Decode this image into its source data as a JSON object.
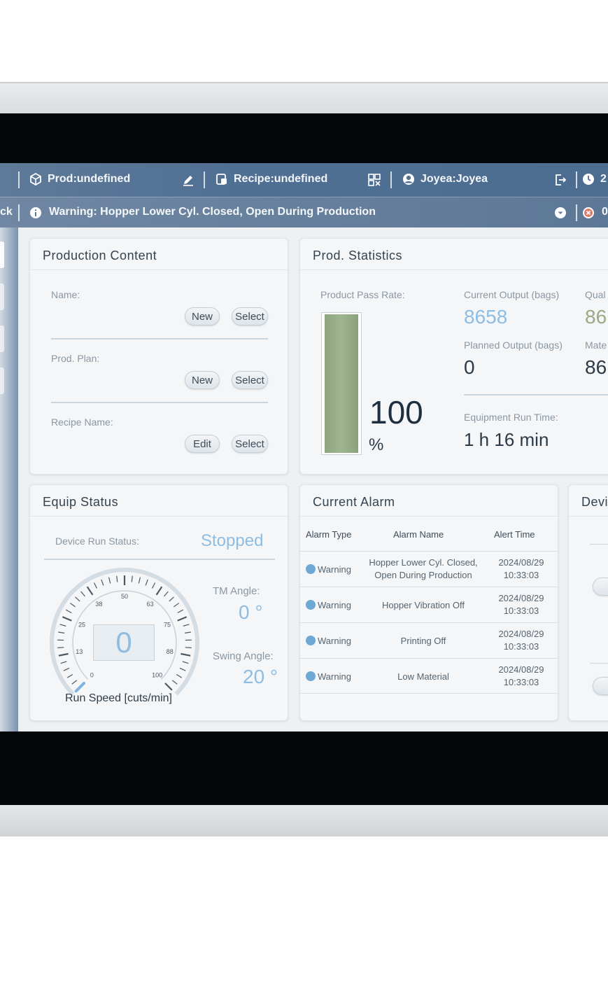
{
  "topbar": {
    "prod_label": "Prod:undefined",
    "recipe_label": "Recipe:undefined",
    "user_label": "Joyea:Joyea",
    "clock_partial": "2"
  },
  "warnbar": {
    "left_fragment": "ck",
    "warning_text": "Warning:  Hopper Lower Cyl. Closed, Open During Production",
    "right_fragment": "0"
  },
  "production_content": {
    "title": "Production Content",
    "name_label": "Name:",
    "plan_label": "Prod. Plan:",
    "recipe_label": "Recipe Name:",
    "new_label": "New",
    "select_label": "Select",
    "edit_label": "Edit"
  },
  "prod_statistics": {
    "title": "Prod. Statistics",
    "pass_rate_label": "Product Pass Rate:",
    "pass_rate_value": "100",
    "pass_rate_unit": "%",
    "pass_rate_fraction": 1.0,
    "current_output_label": "Current Output (bags)",
    "current_output_value": "8658",
    "qual_label_partial": "Qual",
    "qual_value_partial": "86",
    "planned_output_label": "Planned Output (bags)",
    "planned_output_value": "0",
    "mate_label_partial": "Mate",
    "mate_value_partial": "86",
    "run_time_label": "Equipment Run Time:",
    "run_time_value": "1 h 16 min"
  },
  "equip_status": {
    "title": "Equip Status",
    "run_status_label": "Device Run Status:",
    "run_status_value": "Stopped",
    "gauge_value": "0",
    "gauge_ticks": [
      "0",
      "13",
      "25",
      "38",
      "50",
      "63",
      "75",
      "88",
      "100"
    ],
    "gauge_caption": "Run Speed [cuts/min]",
    "tm_angle_label": "TM Angle:",
    "tm_angle_value": "0 °",
    "swing_angle_label": "Swing Angle:",
    "swing_angle_value": "20 °"
  },
  "current_alarm": {
    "title": "Current Alarm",
    "headers": [
      "Alarm Type",
      "Alarm Name",
      "Alert Time"
    ],
    "rows": [
      {
        "type": "Warning",
        "name_1": "Hopper Lower Cyl. Closed,",
        "name_2": "Open During Production",
        "date": "2024/08/29",
        "time": "10:33:03"
      },
      {
        "type": "Warning",
        "name_1": "Hopper Vibration Off",
        "name_2": "",
        "date": "2024/08/29",
        "time": "10:33:03"
      },
      {
        "type": "Warning",
        "name_1": "Printing Off",
        "name_2": "",
        "date": "2024/08/29",
        "time": "10:33:03"
      },
      {
        "type": "Warning",
        "name_1": "Low Material",
        "name_2": "",
        "date": "2024/08/29",
        "time": "10:33:03"
      }
    ]
  },
  "device_panel": {
    "title_partial": "Devi"
  }
}
